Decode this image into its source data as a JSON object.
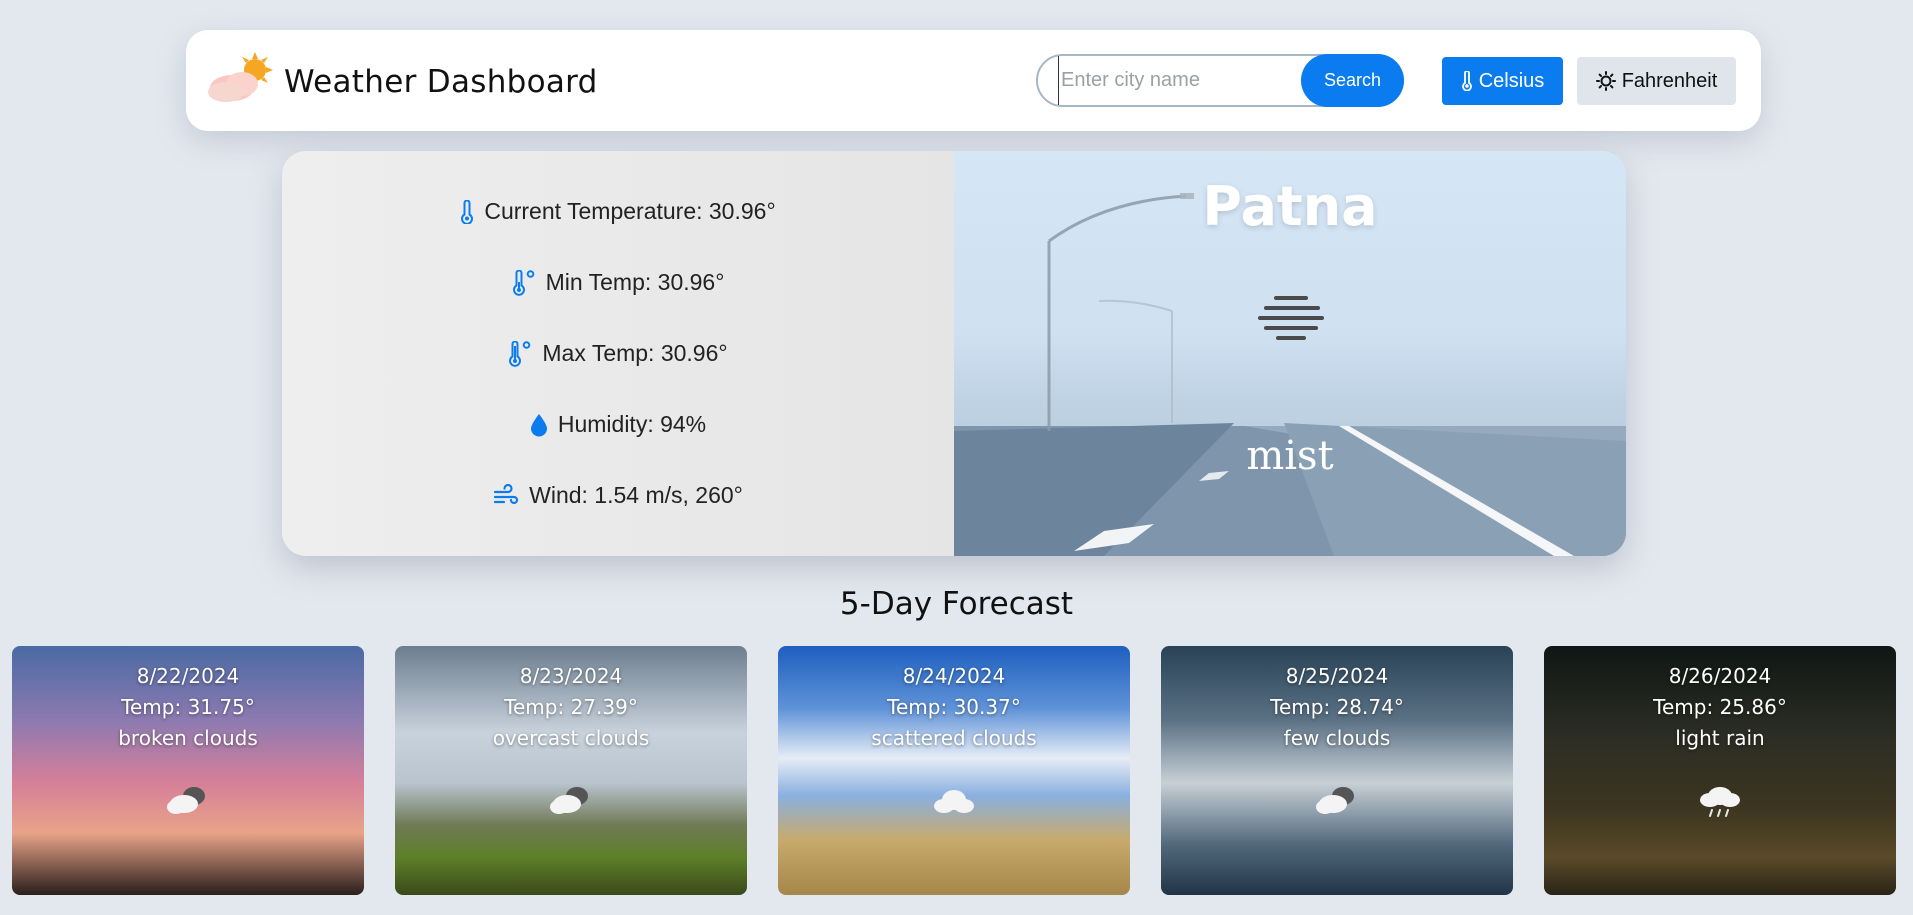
{
  "header": {
    "title": "Weather Dashboard",
    "search_placeholder": "Enter city name",
    "search_label": "Search",
    "celsius_label": "Celsius",
    "fahrenheit_label": "Fahrenheit"
  },
  "current": {
    "city": "Patna",
    "condition": "mist",
    "temperature": "Current Temperature: 30.96°",
    "min_temp": "Min Temp: 30.96°",
    "max_temp": "Max Temp: 30.96°",
    "humidity": "Humidity: 94%",
    "wind": "Wind: 1.54 m/s, 260°"
  },
  "forecast": {
    "title": "5-Day Forecast",
    "days": [
      {
        "date": "8/22/2024",
        "temp": "Temp: 31.75°",
        "desc": "broken clouds"
      },
      {
        "date": "8/23/2024",
        "temp": "Temp: 27.39°",
        "desc": "overcast clouds"
      },
      {
        "date": "8/24/2024",
        "temp": "Temp: 30.37°",
        "desc": "scattered clouds"
      },
      {
        "date": "8/25/2024",
        "temp": "Temp: 28.74°",
        "desc": "few clouds"
      },
      {
        "date": "8/26/2024",
        "temp": "Temp: 25.86°",
        "desc": "light rain"
      }
    ]
  },
  "colors": {
    "accent": "#0b7cf0",
    "background": "#e3e8ef"
  }
}
